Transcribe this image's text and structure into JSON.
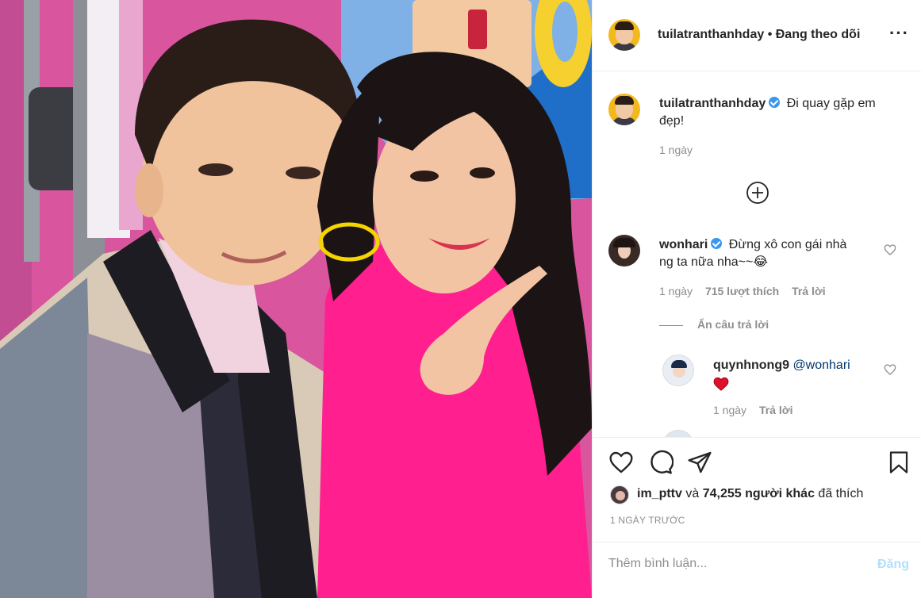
{
  "post": {
    "image_alt_icon": "photo-selfie-illustration",
    "author": "tuilatranthanhday",
    "follow_status": "Đang theo dõi",
    "more_icon": "more-horizontal-icon"
  },
  "caption": {
    "username": "tuilatranthanhday",
    "text_line1": "Đi quay gặp em",
    "text_line2": "đẹp!",
    "time": "1 ngày"
  },
  "load_more_icon": "plus-circle-icon",
  "comments": [
    {
      "username": "wonhari",
      "text_line1": "Đừng xô con gái nhà",
      "text_line2": "ng ta nữa nha~~😂",
      "time": "1 ngày",
      "likes": "715 lượt thích",
      "reply_label": "Trả lời",
      "hide_replies_label": "Ẩn câu trả lời",
      "replies": [
        {
          "username": "quynhnong9",
          "mention": "@wonhari",
          "emoji": "❤️",
          "time": "1 ngày",
          "reply_label": "Trả lời"
        }
      ]
    }
  ],
  "actions": {
    "like_icon": "heart-icon",
    "comment_icon": "comment-icon",
    "share_icon": "send-icon",
    "save_icon": "bookmark-icon"
  },
  "likes": {
    "first_user": "im_pttv",
    "conj": "và",
    "count": "74,255 người khác",
    "suffix": "đã thích"
  },
  "timestamp": "1 NGÀY TRƯỚC",
  "comment_box": {
    "placeholder": "Thêm bình luận...",
    "post_label": "Đăng"
  },
  "colors": {
    "link_blue": "#3897f0",
    "post_disabled": "#b2dffc",
    "heart_red": "#ed4956",
    "muted": "#8e8e8e"
  }
}
